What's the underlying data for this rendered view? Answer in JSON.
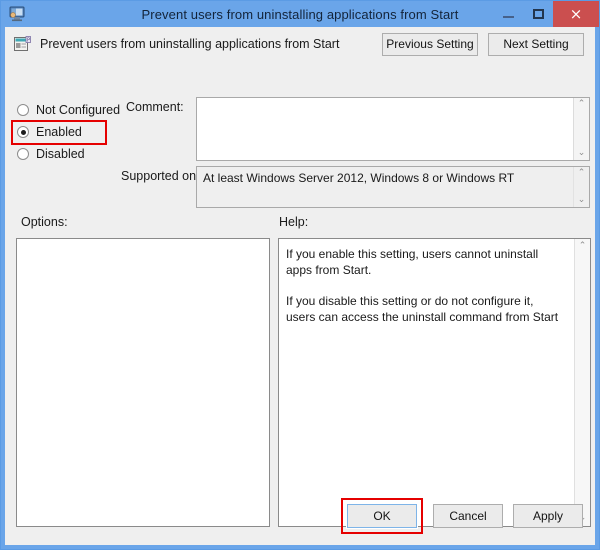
{
  "window": {
    "title": "Prevent users from uninstalling applications from Start",
    "icon": "policy-editor-icon",
    "controls": {
      "minimize": "–",
      "maximize": "□",
      "close": "×"
    }
  },
  "header": {
    "icon": "policy-setting-icon",
    "title": "Prevent users from uninstalling applications from Start",
    "previous_setting": "Previous Setting",
    "next_setting": "Next Setting"
  },
  "state": {
    "options": [
      {
        "label": "Not Configured",
        "checked": false
      },
      {
        "label": "Enabled",
        "checked": true
      },
      {
        "label": "Disabled",
        "checked": false
      }
    ],
    "selected": "Enabled",
    "highlight_color": "#e50000"
  },
  "comment": {
    "label": "Comment:",
    "value": "",
    "placeholder": ""
  },
  "supported": {
    "label": "Supported on:",
    "value": "At least Windows Server 2012, Windows 8 or Windows RT"
  },
  "options_panel": {
    "label": "Options:",
    "value": ""
  },
  "help_panel": {
    "label": "Help:",
    "paragraphs": [
      "If you enable this setting, users cannot uninstall apps from Start.",
      "If you disable this setting or do not configure it, users can access the uninstall command from Start"
    ]
  },
  "buttons": {
    "ok": "OK",
    "cancel": "Cancel",
    "apply": "Apply"
  },
  "scroll": {
    "up": "⌃",
    "down": "⌄"
  },
  "colors": {
    "window_frame": "#6aa5e9",
    "close_button": "#cb4f4f",
    "client_background": "#efefef",
    "focus_border": "#7eb4e8"
  }
}
